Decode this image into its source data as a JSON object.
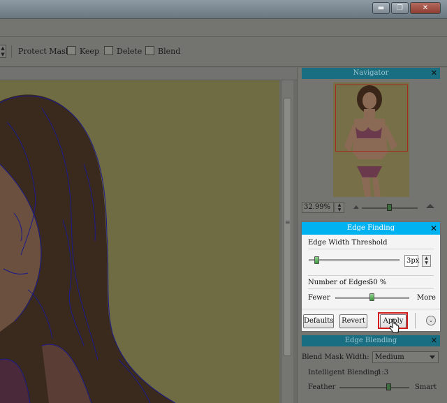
{
  "window": {
    "minimize_glyph": "▬",
    "restore_glyph": "❐",
    "close_glyph": "✕"
  },
  "toolbar": {
    "protect_mask_label": "Protect Mask:",
    "keep_label": "Keep",
    "delete_label": "Delete",
    "blend_label": "Blend"
  },
  "navigator": {
    "title": "Navigator",
    "zoom_value": "32.99%",
    "zoom_level": 0.5
  },
  "edge_finding": {
    "title": "Edge Finding",
    "threshold_label": "Edge Width Threshold",
    "threshold_value": "3px",
    "edges_label": "Number of Edges:",
    "edges_percent": "50 %",
    "fewer_label": "Fewer",
    "more_label": "More",
    "defaults_button": "Defaults",
    "revert_button": "Revert",
    "apply_button": "Apply",
    "edges_level": 0.5
  },
  "edge_blending": {
    "title": "Edge Blending",
    "blend_mask_width_label": "Blend Mask Width:",
    "blend_mask_width_value": "Medium",
    "intelligent_blending_label": "Intelligent Blending:",
    "intelligent_blending_value": "1:3",
    "feather_label": "Feather",
    "smart_label": "Smart"
  },
  "colors": {
    "panel_title_bg": "#1a6e82",
    "dialog_title_bg": "#00b2f0",
    "apply_highlight": "#d41b1b",
    "edge_line": "#1a1a8a"
  },
  "icons": [
    "minimize-icon",
    "restore-icon",
    "close-icon",
    "spin-arrows-icon",
    "mountain-small-icon",
    "mountain-large-icon",
    "expand-chevron-icon",
    "mouse-cursor-icon"
  ]
}
